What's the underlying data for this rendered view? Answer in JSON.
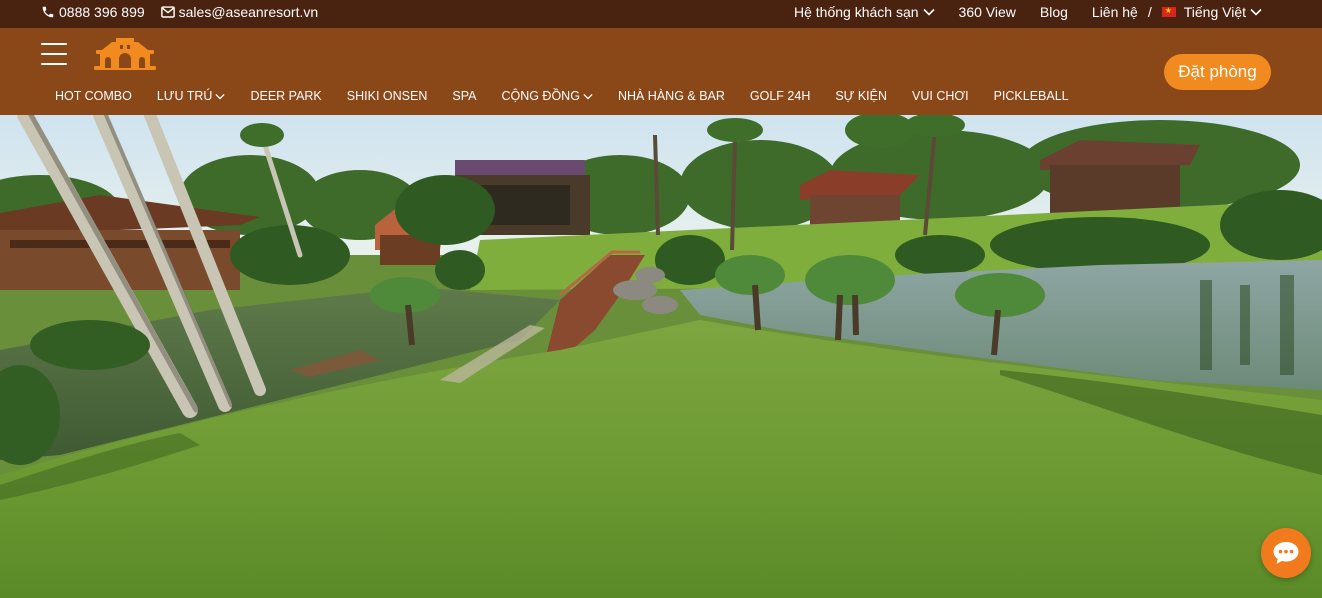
{
  "topbar": {
    "phone": "0888 396 899",
    "email": "sales@aseanresort.vn",
    "links": [
      {
        "label": "Hệ thống khách sạn",
        "dropdown": true
      },
      {
        "label": "360 View",
        "dropdown": false
      },
      {
        "label": "Blog",
        "dropdown": false
      },
      {
        "label": "Liên hệ",
        "dropdown": false
      }
    ],
    "separator": "/",
    "language": "Tiếng Việt",
    "icons": {
      "phone": "phone-icon",
      "email": "envelope-icon",
      "flag": "vietnam-flag-icon",
      "dropdown": "chevron-down-icon"
    }
  },
  "header": {
    "logo_icon": "resort-gate-logo-icon",
    "menu_icon": "hamburger-menu-icon",
    "book_button": "Đặt phòng",
    "nav": [
      {
        "label": "HOT COMBO",
        "dropdown": false
      },
      {
        "label": "LƯU TRÚ",
        "dropdown": true
      },
      {
        "label": "DEER PARK",
        "dropdown": false
      },
      {
        "label": "SHIKI ONSEN",
        "dropdown": false
      },
      {
        "label": "SPA",
        "dropdown": false
      },
      {
        "label": "CỘNG ĐỒNG",
        "dropdown": true
      },
      {
        "label": "NHÀ HÀNG & BAR",
        "dropdown": false
      },
      {
        "label": "GOLF 24H",
        "dropdown": false
      },
      {
        "label": "SỰ KIỆN",
        "dropdown": false
      },
      {
        "label": "VUI CHƠI",
        "dropdown": false
      },
      {
        "label": "PICKLEBALL",
        "dropdown": false
      }
    ]
  },
  "hero": {
    "image_subject": "resort-garden-lake-bridge-photo"
  },
  "chat": {
    "icon": "chat-bubble-icon"
  },
  "colors": {
    "topbar_bg": "#4a2210",
    "header_bg": "#8a4717",
    "accent": "#f18a1f",
    "text": "#ffffff"
  }
}
